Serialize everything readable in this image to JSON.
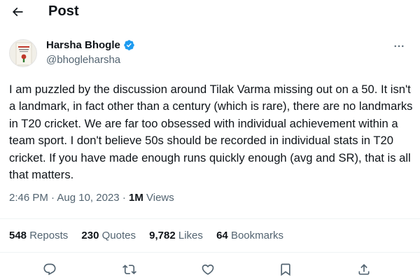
{
  "header": {
    "title": "Post",
    "back_icon": "arrow-left-icon"
  },
  "author": {
    "name": "Harsha Bhogle",
    "handle": "@bhogleharsha",
    "verified_color": "#1d9bf0",
    "avatar_icon": "book-cover-avatar"
  },
  "tweet": {
    "text": "I am puzzled by the discussion around Tilak Varma missing out on a 50. It isn't a landmark, in fact other than a century (which is rare), there are no landmarks in T20 cricket. We are far too obsessed with individual achievement within a team sport. I don't believe 50s should be recorded in individual stats in T20 cricket. If you have made enough runs quickly enough (avg and SR), that is all that matters."
  },
  "meta": {
    "time": "2:46 PM",
    "sep1": "·",
    "date": "Aug 10, 2023",
    "sep2": "·",
    "views_count": "1M",
    "views_label": "Views"
  },
  "stats": [
    {
      "count": "548",
      "label": "Reposts"
    },
    {
      "count": "230",
      "label": "Quotes"
    },
    {
      "count": "9,782",
      "label": "Likes"
    },
    {
      "count": "64",
      "label": "Bookmarks"
    }
  ],
  "actions": [
    "reply-icon",
    "repost-icon",
    "like-icon",
    "bookmark-icon",
    "share-icon"
  ],
  "colors": {
    "text": "#0f1419",
    "secondary": "#536471",
    "divider": "#eff3f4",
    "accent": "#1d9bf0"
  }
}
